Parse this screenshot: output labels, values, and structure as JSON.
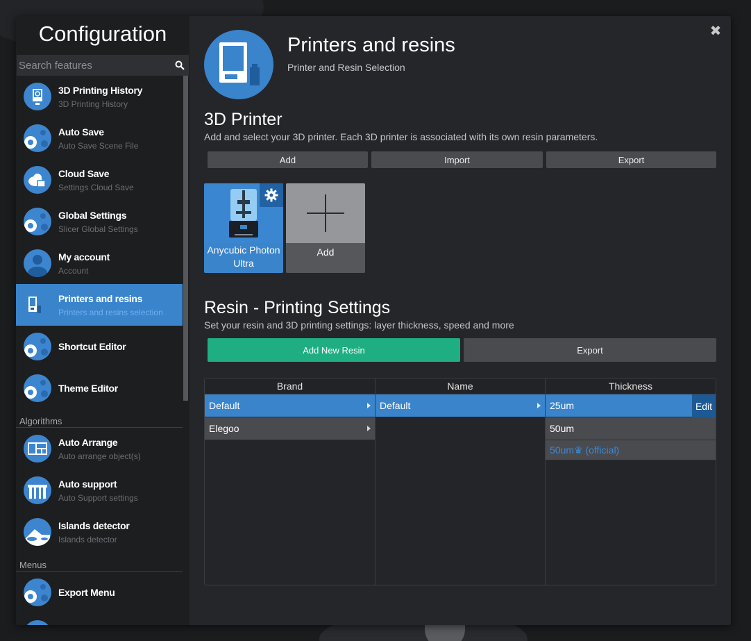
{
  "sidebar": {
    "title": "Configuration",
    "search_placeholder": "Search features",
    "items": [
      {
        "title": "3D Printing History",
        "subtitle": "3D Printing History",
        "icon": "history-icon"
      },
      {
        "title": "Auto Save",
        "subtitle": "Auto Save Scene File",
        "icon": "gear-icon"
      },
      {
        "title": "Cloud Save",
        "subtitle": "Settings Cloud Save",
        "icon": "cloud-icon"
      },
      {
        "title": "Global Settings",
        "subtitle": "Slicer Global Settings",
        "icon": "gear-icon"
      },
      {
        "title": "My account",
        "subtitle": "Account",
        "icon": "user-icon"
      },
      {
        "title": "Printers and resins",
        "subtitle": "Printers and resins selection",
        "icon": "printer-icon",
        "active": true
      },
      {
        "title": "Shortcut Editor",
        "subtitle": "",
        "icon": "gear-icon"
      },
      {
        "title": "Theme Editor",
        "subtitle": "",
        "icon": "gear-icon"
      }
    ],
    "sections": {
      "algorithms": "Algorithms",
      "menus": "Menus"
    },
    "algorithm_items": [
      {
        "title": "Auto Arrange",
        "subtitle": "Auto arrange object(s)",
        "icon": "arrange-icon"
      },
      {
        "title": "Auto support",
        "subtitle": "Auto Support settings",
        "icon": "support-icon"
      },
      {
        "title": "Islands detector",
        "subtitle": "Islands detector",
        "icon": "islands-icon"
      }
    ],
    "menu_items": [
      {
        "title": "Export Menu",
        "subtitle": "",
        "icon": "gear-icon"
      }
    ]
  },
  "header": {
    "title": "Printers and resins",
    "subtitle": "Printer and Resin Selection",
    "close": "✖"
  },
  "printer_section": {
    "heading": "3D Printer",
    "description": "Add and select your 3D printer. Each 3D printer is associated with its own resin parameters.",
    "buttons": {
      "add": "Add",
      "import": "Import",
      "export": "Export"
    },
    "printers": [
      {
        "name": "Anycubic Photon Ultra"
      }
    ],
    "add_card_label": "Add"
  },
  "resin_section": {
    "heading": "Resin - Printing Settings",
    "description": "Set your resin and 3D printing settings: layer thickness, speed and more",
    "buttons": {
      "add_new_resin": "Add New Resin",
      "export": "Export"
    },
    "table": {
      "headers": {
        "brand": "Brand",
        "name": "Name",
        "thickness": "Thickness"
      },
      "brands": [
        "Default",
        "Elegoo"
      ],
      "names": [
        "Default"
      ],
      "thickness": [
        "25um",
        "50um",
        "50um♛ (official)"
      ],
      "edit_label": "Edit"
    }
  },
  "colors": {
    "accent": "#3a84cc",
    "green": "#1fae82",
    "panel": "#242528",
    "sidebar": "#1d1e20"
  }
}
